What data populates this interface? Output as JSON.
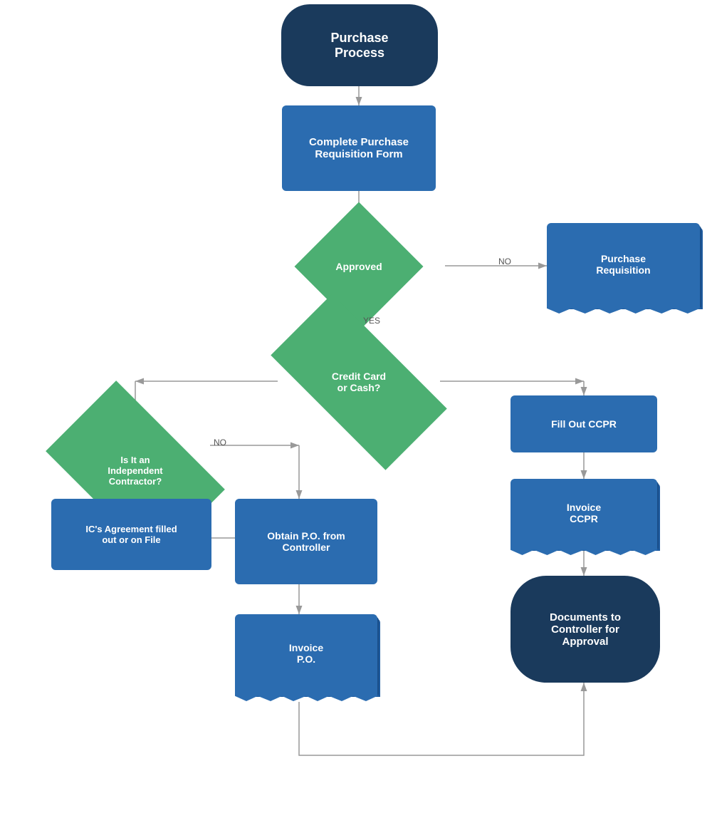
{
  "title": "Purchase Process",
  "nodes": {
    "start": {
      "label": "Purchase\nProcess"
    },
    "complete_form": {
      "label": "Complete Purchase\nRequisition Form"
    },
    "approved": {
      "label": "Approved"
    },
    "purchase_requisition": {
      "label": "Purchase\nRequisition"
    },
    "credit_card_cash": {
      "label": "Credit Card\nor Cash?"
    },
    "fill_ccpr": {
      "label": "Fill Out CCPR"
    },
    "invoice_ccpr": {
      "label": "Invoice\nCCPR"
    },
    "documents_controller": {
      "label": "Documents to\nController for\nApproval"
    },
    "is_independent": {
      "label": "Is It an\nIndependent\nContractor?"
    },
    "ics_agreement": {
      "label": "IC's Agreement filled\nout or on File"
    },
    "obtain_po": {
      "label": "Obtain P.O. from\nController"
    },
    "invoice_po": {
      "label": "Invoice\nP.O."
    }
  },
  "labels": {
    "no": "NO",
    "yes": "YES"
  }
}
